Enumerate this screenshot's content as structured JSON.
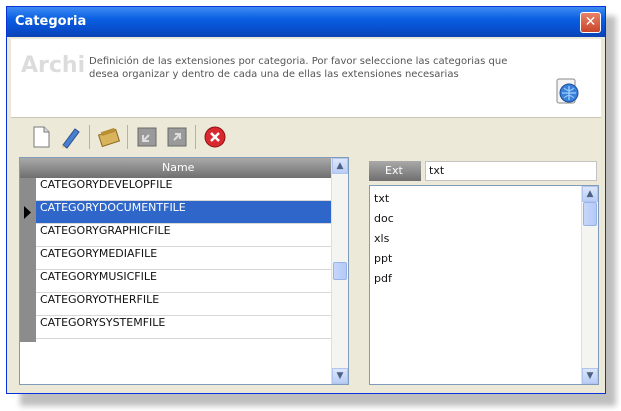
{
  "window": {
    "title": "Categoria",
    "close_glyph": "✕"
  },
  "header": {
    "watermark": "Archi",
    "description": "Definición de las extensiones por categoria. Por favor seleccione las categorias que desea organizar y dentro de cada una de ellas las extensiones necesarias",
    "icon": "document-globe-icon"
  },
  "toolbar": {
    "icons": [
      "new-document-icon",
      "edit-icon",
      "package-icon",
      "import-icon",
      "export-icon",
      "delete-icon"
    ]
  },
  "categories": {
    "column_header": "Name",
    "rows": [
      "CATEGORYDEVELOPFILE",
      "CATEGORYDOCUMENTFILE",
      "CATEGORYGRAPHICFILE",
      "CATEGORYMEDIAFILE",
      "CATEGORYMUSICFILE",
      "CATEGORYOTHERFILE",
      "CATEGORYSYSTEMFILE"
    ],
    "selected_index": 1
  },
  "extensions": {
    "header": "Ext",
    "input_value": "txt",
    "items": [
      "txt",
      "doc",
      "xls",
      "ppt",
      "pdf"
    ]
  },
  "colors": {
    "title_bar": "#0a5fe2",
    "selection": "#2f66c9",
    "close": "#c8442a"
  }
}
